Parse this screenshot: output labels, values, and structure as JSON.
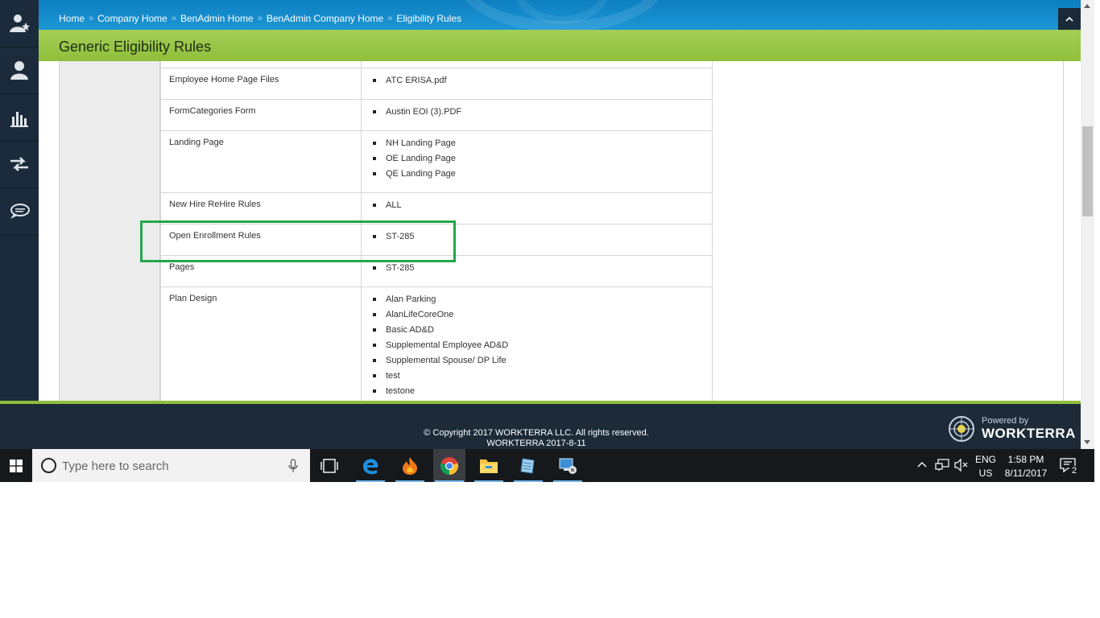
{
  "sidebar": {
    "items": [
      {
        "icon": "user-star-icon"
      },
      {
        "icon": "user-icon"
      },
      {
        "icon": "bar-chart-icon"
      },
      {
        "icon": "transfer-arrows-icon"
      },
      {
        "icon": "chat-bubble-icon"
      }
    ]
  },
  "breadcrumb": [
    {
      "label": "Home"
    },
    {
      "label": "Company Home"
    },
    {
      "label": "BenAdmin Home"
    },
    {
      "label": "BenAdmin Company Home"
    },
    {
      "label": "Eligibility Rules"
    }
  ],
  "breadcrumb_separator": "»",
  "page": {
    "title": "Generic Eligibility Rules"
  },
  "rules": [
    {
      "label": "Employee Home Page Files",
      "values": [
        "ATC ERISA.pdf"
      ]
    },
    {
      "label": "FormCategories Form",
      "values": [
        "Austin EOI (3).PDF"
      ]
    },
    {
      "label": "Landing Page",
      "values": [
        "NH Landing Page",
        "OE Landing Page",
        "QE Landing Page"
      ]
    },
    {
      "label": "New Hire ReHire Rules",
      "values": [
        "ALL"
      ]
    },
    {
      "label": "Open Enrollment Rules",
      "values": [
        "ST-285"
      ]
    },
    {
      "label": "Pages",
      "values": [
        "ST-285"
      ]
    },
    {
      "label": "Plan Design",
      "values": [
        "Alan Parking",
        "AlanLifeCoreOne",
        "Basic AD&D",
        "Supplemental Employee AD&D",
        "Supplemental Spouse/ DP Life",
        "test",
        "testone"
      ]
    }
  ],
  "footer": {
    "copyright": "© Copyright 2017 WORKTERRA LLC. All rights reserved.",
    "version": "WORKTERRA 2017-8-11",
    "powered_by": "Powered by",
    "brand": "WORKTERRA"
  },
  "taskbar": {
    "search_placeholder": "Type here to search",
    "apps": [
      "edge-icon",
      "flame-app-icon",
      "chrome-icon",
      "file-explorer-icon",
      "notepad-icon",
      "remote-desktop-icon"
    ],
    "lang_line1": "ENG",
    "lang_line2": "US",
    "time": "1:58 PM",
    "date": "8/11/2017",
    "notification_count": "2"
  },
  "colors": {
    "breadcrumb_bar": "#1c96d6",
    "title_bar": "#9cc84b",
    "sidebar": "#1c2b3b",
    "highlight": "#21a84a"
  }
}
